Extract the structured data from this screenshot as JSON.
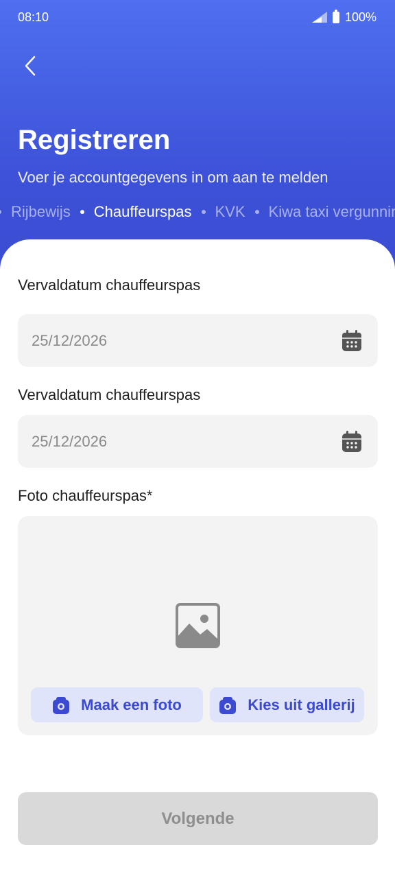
{
  "status_bar": {
    "time": "08:10",
    "battery": "100%"
  },
  "header": {
    "title": "Registreren",
    "subtitle": "Voer je accountgegevens in om aan te melden",
    "steps": [
      {
        "label": "Rijbewijs",
        "active": false
      },
      {
        "label": "Chauffeurspas",
        "active": true
      },
      {
        "label": "KVK",
        "active": false
      },
      {
        "label": "Kiwa taxi vergunning",
        "active": false
      }
    ]
  },
  "form": {
    "field1": {
      "label": "Vervaldatum chauffeurspas",
      "value": "25/12/2026"
    },
    "field2": {
      "label": "Vervaldatum chauffeurspas",
      "value": "25/12/2026"
    },
    "photo": {
      "label": "Foto chauffeurspas*",
      "take_photo_label": "Maak een foto",
      "gallery_label": "Kies uit gallerij"
    }
  },
  "next_button": {
    "label": "Volgende"
  },
  "colors": {
    "primary": "#3d52d8",
    "button_tint": "#e0e4fb",
    "disabled": "#d9d9d9"
  },
  "icons": [
    "back-arrow-icon",
    "calendar-icon",
    "image-placeholder-icon",
    "camera-icon",
    "signal-icon",
    "battery-icon"
  ]
}
